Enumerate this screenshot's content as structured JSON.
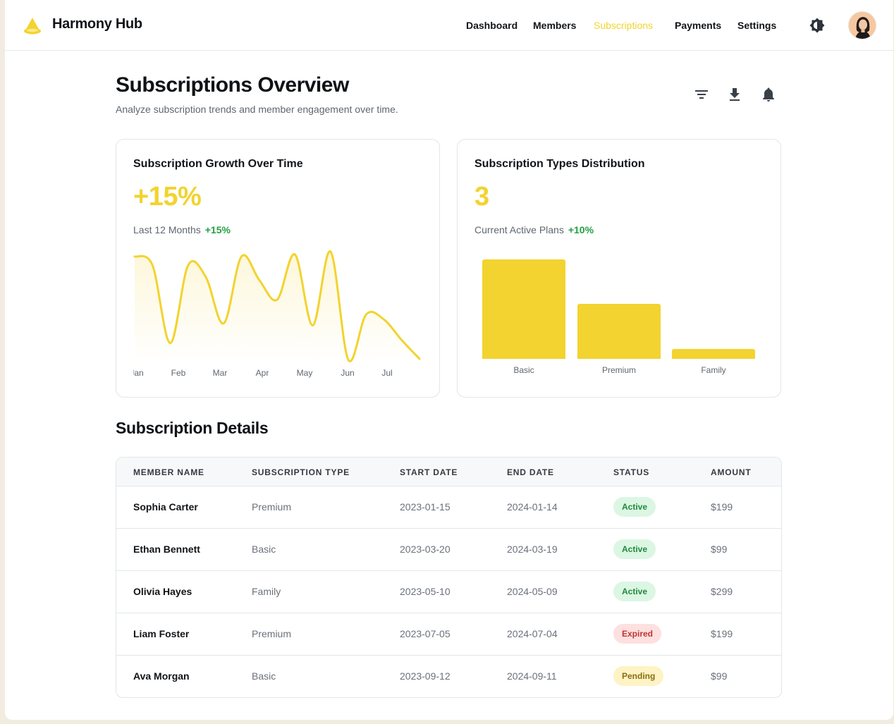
{
  "app": {
    "brand": "Harmony Hub"
  },
  "nav": {
    "items": [
      {
        "label": "Dashboard",
        "active": false
      },
      {
        "label": "Members",
        "active": false
      },
      {
        "label": "Subscriptions",
        "active": true
      },
      {
        "label": "Payments",
        "active": false
      },
      {
        "label": "Settings",
        "active": false
      }
    ]
  },
  "page": {
    "title": "Subscriptions Overview",
    "subtitle": "Analyze subscription trends and member engagement over time."
  },
  "icons": {
    "toolbar": [
      "filter-icon",
      "download-icon",
      "bell-icon"
    ],
    "header": [
      "theme-toggle-icon",
      "user-avatar"
    ]
  },
  "colors": {
    "accent": "#f2d32f",
    "positive": "#22a045"
  },
  "growth_card": {
    "title": "Subscription Growth Over Time",
    "big_value": "+15%",
    "meta_label": "Last 12 Months",
    "meta_delta": "+15%",
    "chart_data": {
      "type": "area",
      "categories": [
        "Jan",
        "Feb",
        "Mar",
        "Apr",
        "May",
        "Jun",
        "Jul"
      ],
      "series": [
        {
          "values": [
            109,
            100,
            21,
            100,
            88,
            41,
            109,
            85,
            65,
            111,
            39,
            114,
            4,
            50,
            45,
            24,
            5
          ]
        }
      ],
      "ylim": [
        0,
        116
      ]
    }
  },
  "types_card": {
    "title": "Subscription Types Distribution",
    "big_value": "3",
    "meta_label": "Current Active Plans",
    "meta_delta": "+10%",
    "chart_data": {
      "type": "bar",
      "categories": [
        "Basic",
        "Premium",
        "Family"
      ],
      "values": [
        100,
        55,
        10
      ],
      "ylim": [
        0,
        100
      ]
    }
  },
  "table": {
    "title": "Subscription Details",
    "columns": [
      "MEMBER NAME",
      "SUBSCRIPTION TYPE",
      "START DATE",
      "END DATE",
      "STATUS",
      "AMOUNT"
    ],
    "rows": [
      {
        "name": "Sophia Carter",
        "type": "Premium",
        "start": "2023-01-15",
        "end": "2024-01-14",
        "status": "Active",
        "status_kind": "active",
        "amount": "$199"
      },
      {
        "name": "Ethan Bennett",
        "type": "Basic",
        "start": "2023-03-20",
        "end": "2024-03-19",
        "status": "Active",
        "status_kind": "active",
        "amount": "$99"
      },
      {
        "name": "Olivia Hayes",
        "type": "Family",
        "start": "2023-05-10",
        "end": "2024-05-09",
        "status": "Active",
        "status_kind": "active",
        "amount": "$299"
      },
      {
        "name": "Liam Foster",
        "type": "Premium",
        "start": "2023-07-05",
        "end": "2024-07-04",
        "status": "Expired",
        "status_kind": "expired",
        "amount": "$199"
      },
      {
        "name": "Ava Morgan",
        "type": "Basic",
        "start": "2023-09-12",
        "end": "2024-09-11",
        "status": "Pending",
        "status_kind": "pending",
        "amount": "$99"
      }
    ]
  }
}
